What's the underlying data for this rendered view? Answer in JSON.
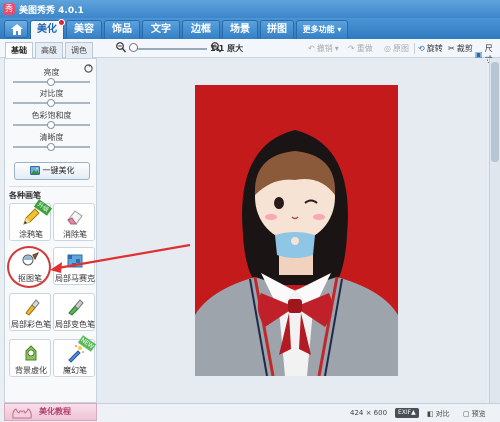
{
  "app": {
    "title": "美图秀秀 4.0.1",
    "logo_glyph": "秀"
  },
  "tabs": [
    {
      "label": "美化",
      "active": true
    },
    {
      "label": "美容"
    },
    {
      "label": "饰品"
    },
    {
      "label": "文字"
    },
    {
      "label": "边框"
    },
    {
      "label": "场景"
    },
    {
      "label": "拼图"
    },
    {
      "label": "更多功能 ▾"
    }
  ],
  "subtabs": [
    {
      "label": "基础",
      "active": true
    },
    {
      "label": "高级"
    },
    {
      "label": "调色"
    }
  ],
  "toolbar": {
    "zoom_label": "1:1 原大",
    "undo": "撤销",
    "redo": "重做",
    "original": "原图",
    "rotate": "旋转",
    "crop": "裁剪",
    "resize": "尺寸"
  },
  "adjustments": [
    {
      "label": "亮度",
      "level": 0.5
    },
    {
      "label": "对比度",
      "level": 0.5
    },
    {
      "label": "色彩饱和度",
      "level": 0.5
    },
    {
      "label": "清晰度",
      "level": 0.5
    }
  ],
  "one_key_label": "一键美化",
  "brushes_title": "各种画笔",
  "brushes": [
    {
      "label": "涂鸦笔",
      "icon": "pencil-icon",
      "badge": "升级"
    },
    {
      "label": "消除笔",
      "icon": "eraser-icon"
    },
    {
      "label": "抠图笔",
      "icon": "cutout-brush-icon",
      "selected": true
    },
    {
      "label": "局部马赛克",
      "icon": "mosaic-icon"
    },
    {
      "label": "局部彩色笔",
      "icon": "color-brush-icon"
    },
    {
      "label": "局部变色笔",
      "icon": "recolor-brush-icon"
    },
    {
      "label": "背景虚化",
      "icon": "blur-background-icon"
    },
    {
      "label": "魔幻笔",
      "icon": "magic-wand-icon",
      "badge": "NEW"
    }
  ],
  "tutorial_label": "美化教程",
  "status": {
    "dimensions": "424 × 600",
    "exif": "EXIF▲",
    "compare": "对比",
    "preview": "预览"
  },
  "colors": {
    "accent": "#3d86c9",
    "photo_bg": "#c41a1c",
    "annotation": "#e03030"
  }
}
